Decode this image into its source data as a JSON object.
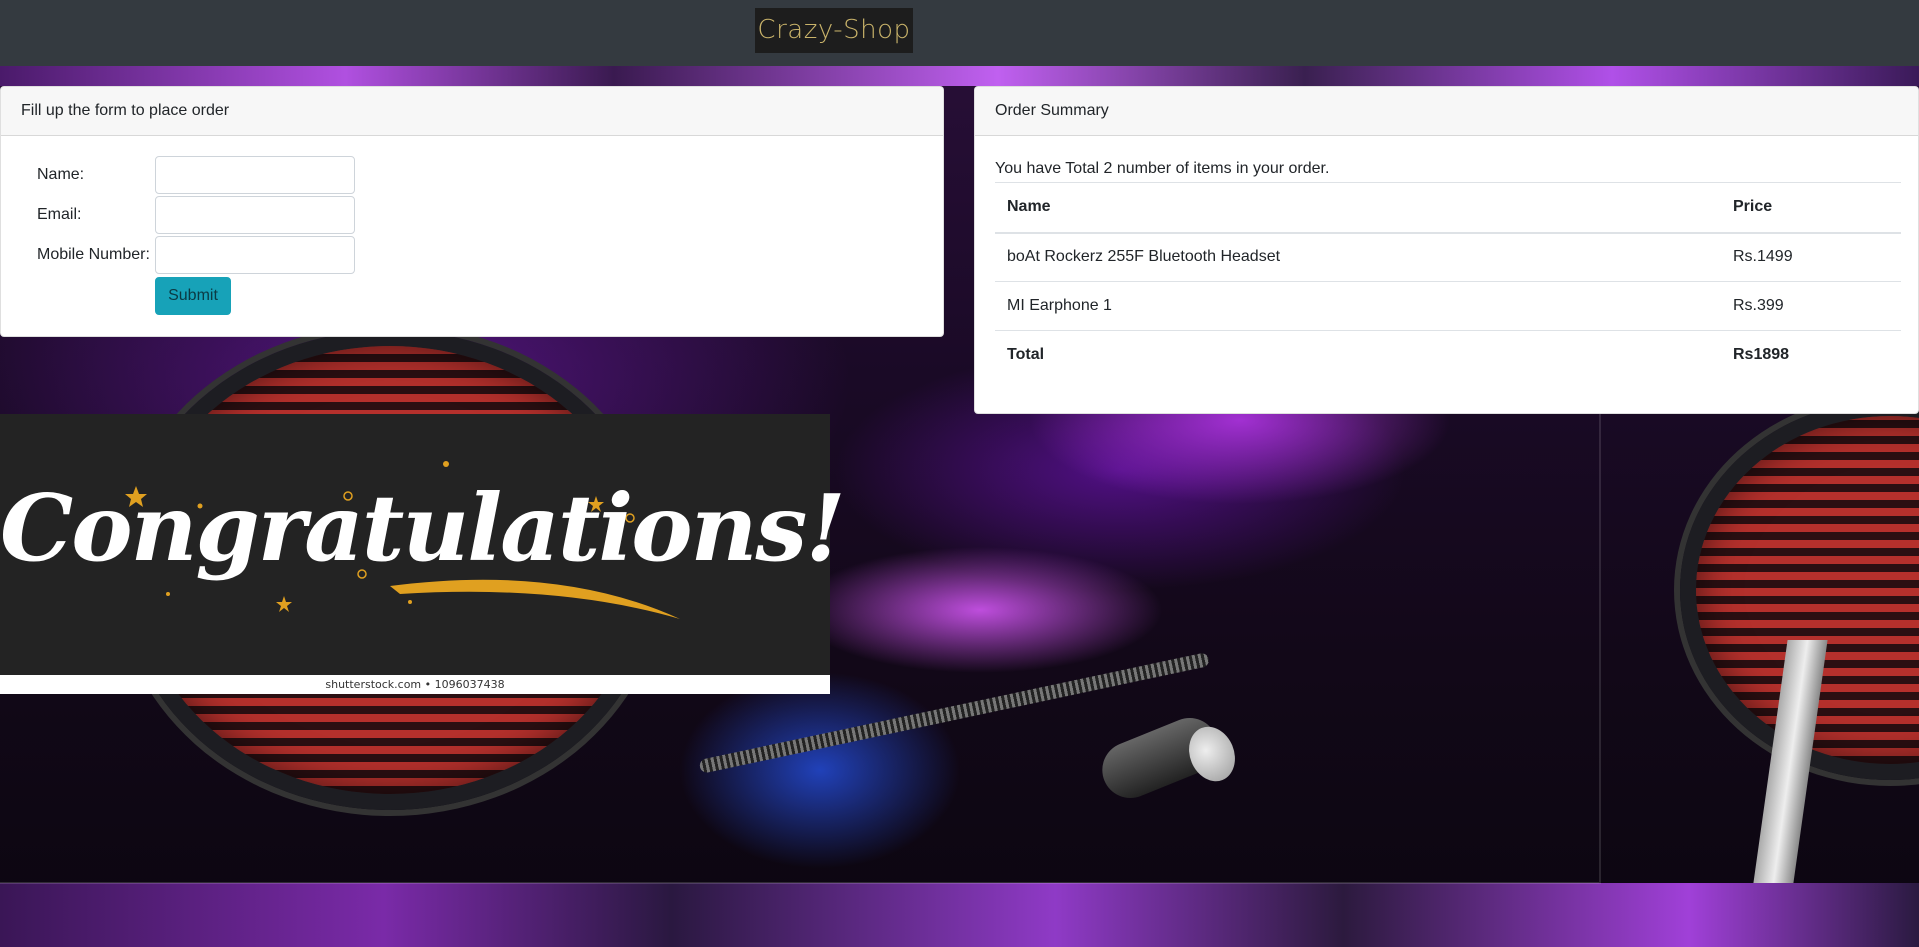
{
  "navbar": {
    "brand": "Crazy-Shop"
  },
  "order_form": {
    "header": "Fill up the form to place order",
    "fields": {
      "name_label": "Name:",
      "name_value": "",
      "email_label": "Email:",
      "email_value": "",
      "mobile_label": "Mobile Number:",
      "mobile_value": ""
    },
    "submit_label": "Submit"
  },
  "order_summary": {
    "header": "Order Summary",
    "intro_text": "You have Total 2 number of items in your order.",
    "columns": {
      "name": "Name",
      "price": "Price"
    },
    "items": [
      {
        "name": "boAt Rockerz 255F Bluetooth Headset",
        "price": "Rs.1499"
      },
      {
        "name": "MI Earphone 1",
        "price": "Rs.399"
      }
    ],
    "total_label": "Total",
    "total_value": "Rs1898"
  },
  "banner": {
    "word": "Congratulations!",
    "footer": "shutterstock.com • 1096037438"
  },
  "colors": {
    "navbar_bg": "#343a40",
    "brand_text": "#c9b36a",
    "submit_bg": "#17a2b8",
    "banner_bg": "#232323",
    "banner_swash": "#e0a020"
  }
}
